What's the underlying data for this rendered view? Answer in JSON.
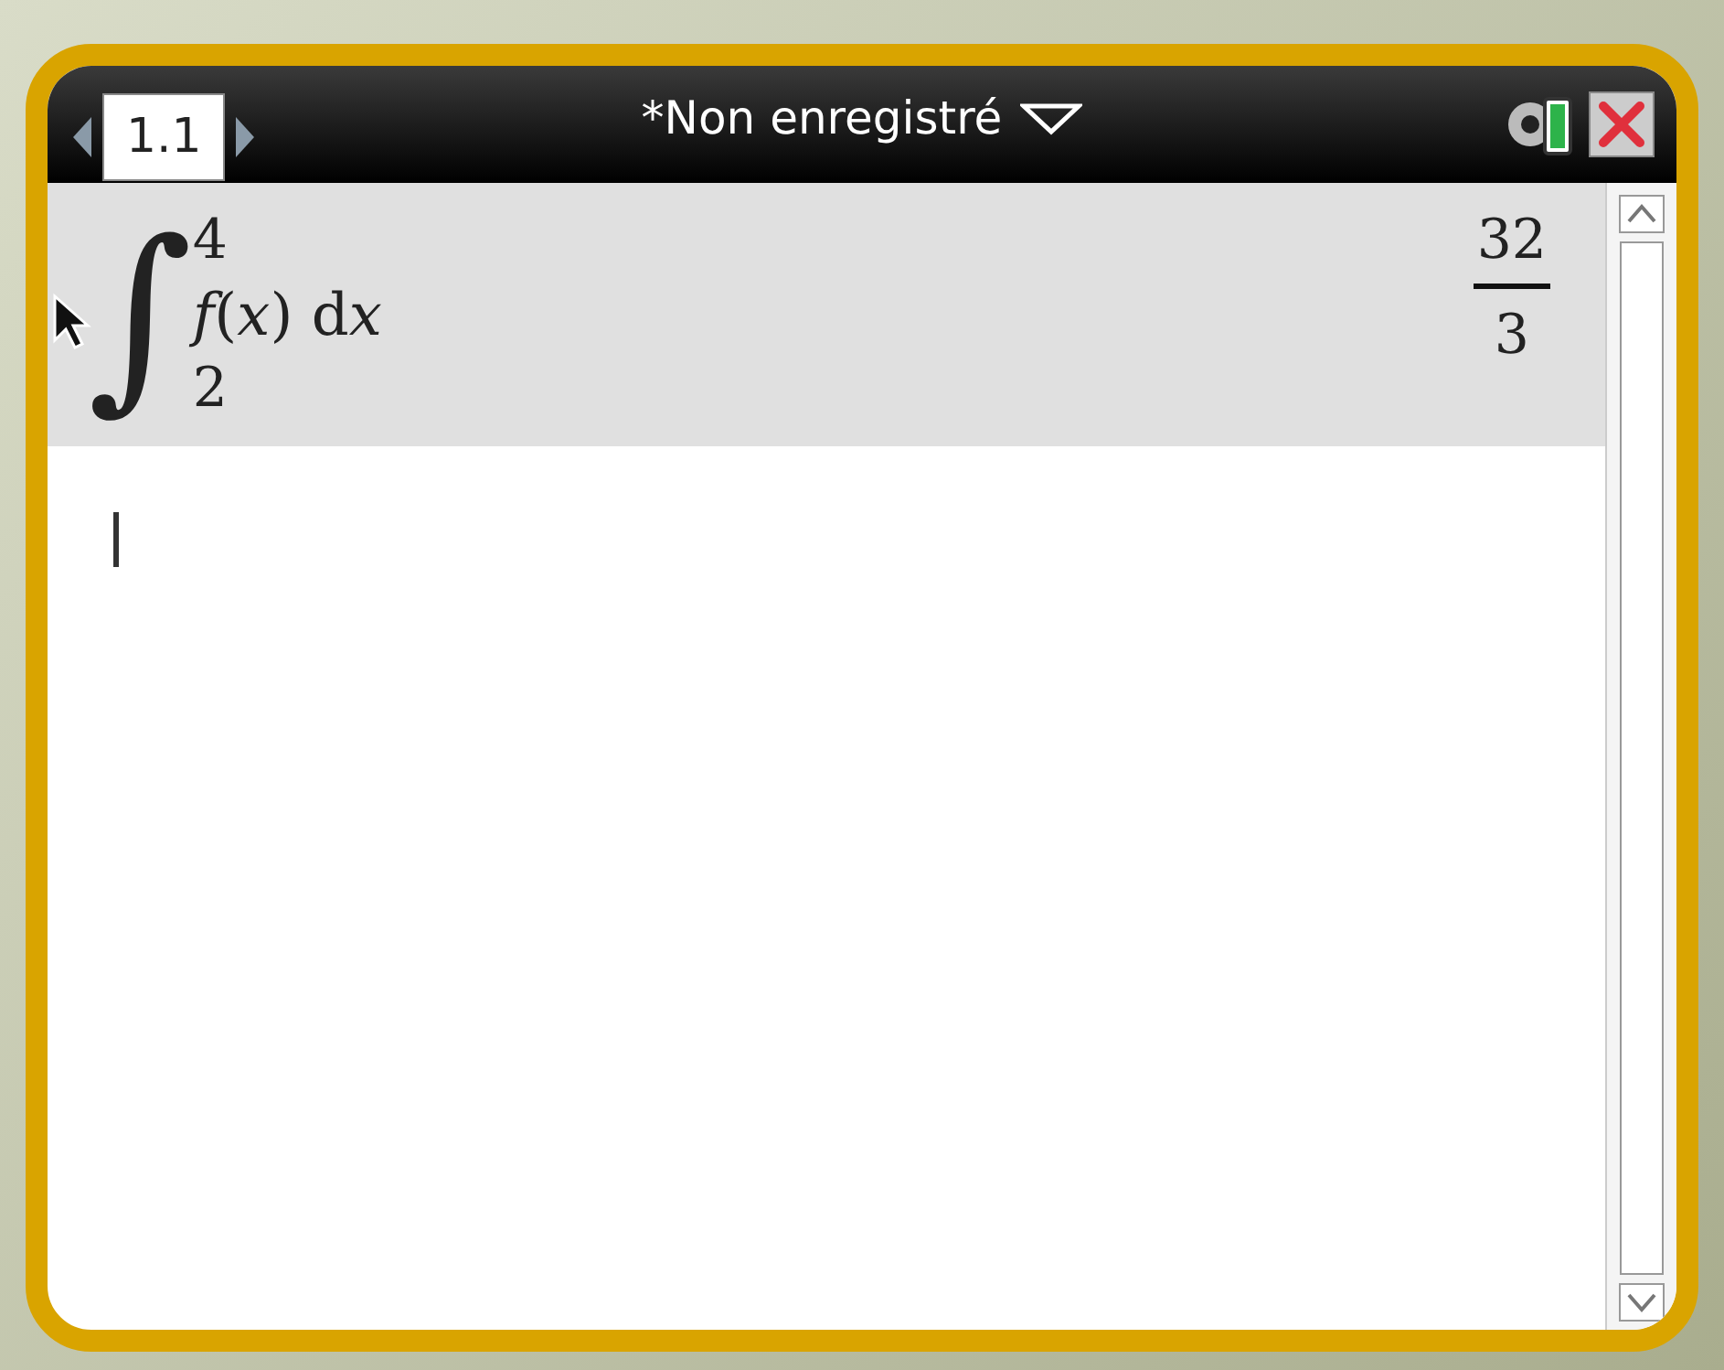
{
  "title": "*Non enregistré",
  "tabs": [
    {
      "label": "1.1",
      "selected": true
    }
  ],
  "entries": [
    {
      "integral_sign": "∫",
      "upper": "4",
      "lower": "2",
      "integrand": "*f*(*x*)",
      "differential": "d",
      "differential_variable": "x",
      "numerator": "32",
      "denominator": "3"
    }
  ]
}
